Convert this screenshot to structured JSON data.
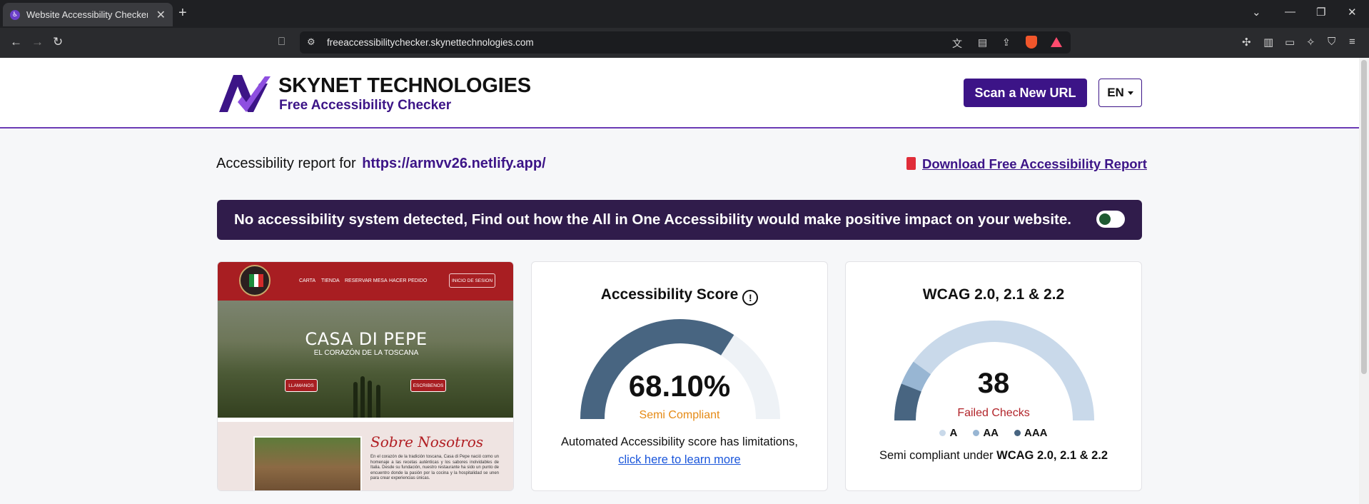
{
  "browser": {
    "tab_title": "Website Accessibility Checker -",
    "url": "freeaccessibilitychecker.skynettechnologies.com"
  },
  "header": {
    "brand": "SKYNET TECHNOLOGIES",
    "tagline": "Free Accessibility Checker",
    "scan_button": "Scan a New URL",
    "lang_button": "EN"
  },
  "report": {
    "prefix": "Accessibility report for",
    "url": "https://armvv26.netlify.app/",
    "download_link": "Download Free Accessibility Report"
  },
  "banner": {
    "text": "No accessibility system detected, Find out how the All in One Accessibility would make positive impact on your website."
  },
  "preview": {
    "nav_items": [
      "CARTA",
      "TIENDA",
      "RESERVAR MESA",
      "HACER PEDIDO"
    ],
    "login": "INICIO DE SESION",
    "hero_title": "CASA DI PEPE",
    "hero_subtitle": "EL CORAZÓN DE LA TOSCANA",
    "btn_call": "LLAMANOS",
    "btn_write": "ESCRIBENOS",
    "about_title": "Sobre Nosotros",
    "about_text": "En el corazón de la tradición toscana, Casa di Pepe nació como un homenaje a las recetas auténticas y los sabores inolvidables de Italia. Desde su fundación, nuestro restaurante ha sido un punto de encuentro donde la pasión por la cocina y la hospitalidad se unen para crear experiencias únicas."
  },
  "score": {
    "title": "Accessibility Score",
    "value": "68.10%",
    "percent": 68.1,
    "status": "Semi Compliant",
    "note": "Automated Accessibility score has limitations,",
    "link": "click here to learn more"
  },
  "wcag": {
    "title": "WCAG 2.0, 2.1 & 2.2",
    "failed_count": "38",
    "failed_label": "Failed Checks",
    "legend": [
      "A",
      "AA",
      "AAA"
    ],
    "under_prefix": "Semi compliant under",
    "under_bold": "WCAG 2.0, 2.1 & 2.2"
  },
  "colors": {
    "brand_purple": "#3c1487",
    "gauge_dark": "#486581",
    "gauge_light": "#eef2f6",
    "wcag_a": "#c9d9ea",
    "wcag_aa": "#98b6d3",
    "wcag_aaa": "#486581"
  }
}
